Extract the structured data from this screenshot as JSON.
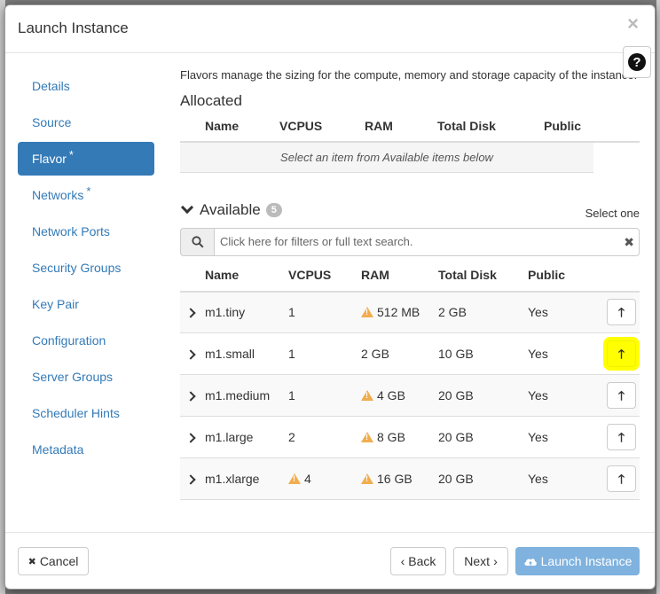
{
  "modal": {
    "title": "Launch Instance",
    "close_glyph": "×",
    "help_glyph": "?"
  },
  "sidebar": {
    "items": [
      {
        "label": "Details",
        "required": false,
        "active": false
      },
      {
        "label": "Source",
        "required": false,
        "active": false
      },
      {
        "label": "Flavor",
        "required": true,
        "active": true
      },
      {
        "label": "Networks",
        "required": true,
        "active": false
      },
      {
        "label": "Network Ports",
        "required": false,
        "active": false
      },
      {
        "label": "Security Groups",
        "required": false,
        "active": false
      },
      {
        "label": "Key Pair",
        "required": false,
        "active": false
      },
      {
        "label": "Configuration",
        "required": false,
        "active": false
      },
      {
        "label": "Server Groups",
        "required": false,
        "active": false
      },
      {
        "label": "Scheduler Hints",
        "required": false,
        "active": false
      },
      {
        "label": "Metadata",
        "required": false,
        "active": false
      }
    ],
    "required_mark": "*"
  },
  "content": {
    "description": "Flavors manage the sizing for the compute, memory and storage capacity of the instance.",
    "allocated": {
      "heading": "Allocated",
      "columns": [
        "Name",
        "VCPUS",
        "RAM",
        "Total Disk",
        "Public"
      ],
      "empty_text": "Select an item from Available items below"
    },
    "available": {
      "heading": "Available",
      "count": "5",
      "select_hint": "Select one",
      "search_placeholder": "Click here for filters or full text search.",
      "search_clear": "✖",
      "columns": [
        "Name",
        "VCPUS",
        "RAM",
        "Total Disk",
        "Public"
      ],
      "rows": [
        {
          "name": "m1.tiny",
          "vcpus": "1",
          "vcpus_warn": false,
          "ram": "512 MB",
          "ram_warn": true,
          "disk": "2 GB",
          "public": "Yes",
          "highlighted": false
        },
        {
          "name": "m1.small",
          "vcpus": "1",
          "vcpus_warn": false,
          "ram": "2 GB",
          "ram_warn": false,
          "disk": "10 GB",
          "public": "Yes",
          "highlighted": true
        },
        {
          "name": "m1.medium",
          "vcpus": "1",
          "vcpus_warn": false,
          "ram": "4 GB",
          "ram_warn": true,
          "disk": "20 GB",
          "public": "Yes",
          "highlighted": false
        },
        {
          "name": "m1.large",
          "vcpus": "2",
          "vcpus_warn": false,
          "ram": "8 GB",
          "ram_warn": true,
          "disk": "20 GB",
          "public": "Yes",
          "highlighted": false
        },
        {
          "name": "m1.xlarge",
          "vcpus": "4",
          "vcpus_warn": true,
          "ram": "16 GB",
          "ram_warn": true,
          "disk": "20 GB",
          "public": "Yes",
          "highlighted": false
        }
      ]
    }
  },
  "footer": {
    "cancel_label": "Cancel",
    "cancel_icon": "✖",
    "back_label": "Back",
    "next_label": "Next",
    "launch_label": "Launch Instance"
  },
  "colors": {
    "primary": "#337ab7",
    "primary_disabled": "#7fb2de",
    "warning": "#f0ad4e",
    "highlight": "#ffff00"
  }
}
